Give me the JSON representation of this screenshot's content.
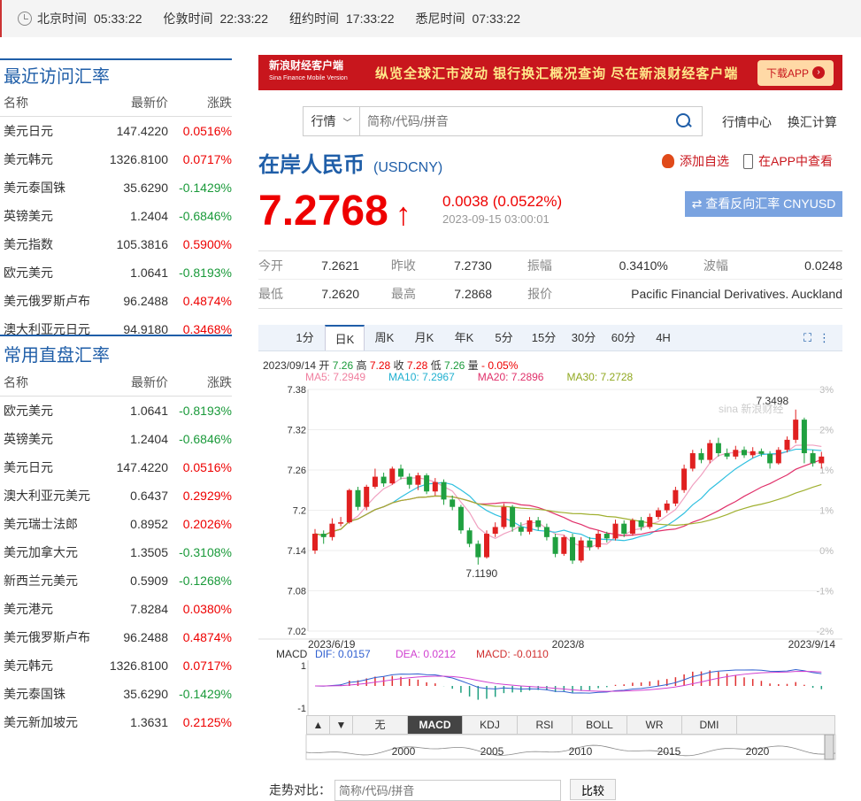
{
  "topbar": {
    "zones": [
      {
        "name": "北京时间",
        "time": "05:33:22"
      },
      {
        "name": "伦敦时间",
        "time": "22:33:22"
      },
      {
        "name": "纽约时间",
        "time": "17:33:22"
      },
      {
        "name": "悉尼时间",
        "time": "07:33:22"
      }
    ]
  },
  "recent": {
    "title": "最近访问汇率",
    "headers": [
      "名称",
      "最新价",
      "涨跌"
    ],
    "rows": [
      [
        "美元日元",
        "147.4220",
        "0.0516%",
        "up"
      ],
      [
        "美元韩元",
        "1326.8100",
        "0.0717%",
        "up"
      ],
      [
        "美元泰国铢",
        "35.6290",
        "-0.1429%",
        "dn"
      ],
      [
        "英镑美元",
        "1.2404",
        "-0.6846%",
        "dn"
      ],
      [
        "美元指数",
        "105.3816",
        "0.5900%",
        "up"
      ],
      [
        "欧元美元",
        "1.0641",
        "-0.8193%",
        "dn"
      ],
      [
        "美元俄罗斯卢布",
        "96.2488",
        "0.4874%",
        "up"
      ],
      [
        "澳大利亚元日元",
        "94.9180",
        "0.3468%",
        "up"
      ]
    ]
  },
  "common": {
    "title": "常用直盘汇率",
    "headers": [
      "名称",
      "最新价",
      "涨跌"
    ],
    "rows": [
      [
        "欧元美元",
        "1.0641",
        "-0.8193%",
        "dn"
      ],
      [
        "英镑美元",
        "1.2404",
        "-0.6846%",
        "dn"
      ],
      [
        "美元日元",
        "147.4220",
        "0.0516%",
        "up"
      ],
      [
        "澳大利亚元美元",
        "0.6437",
        "0.2929%",
        "up"
      ],
      [
        "美元瑞士法郎",
        "0.8952",
        "0.2026%",
        "up"
      ],
      [
        "美元加拿大元",
        "1.3505",
        "-0.3108%",
        "dn"
      ],
      [
        "新西兰元美元",
        "0.5909",
        "-0.1268%",
        "dn"
      ],
      [
        "美元港元",
        "7.8284",
        "0.0380%",
        "up"
      ],
      [
        "美元俄罗斯卢布",
        "96.2488",
        "0.4874%",
        "up"
      ],
      [
        "美元韩元",
        "1326.8100",
        "0.0717%",
        "up"
      ],
      [
        "美元泰国铢",
        "35.6290",
        "-0.1429%",
        "dn"
      ],
      [
        "美元新加坡元",
        "1.3631",
        "0.2125%",
        "up"
      ]
    ]
  },
  "banner": {
    "logo_cn": "新浪财经客户端",
    "logo_en": "Sina Finance Mobile Version",
    "slogan": "纵览全球汇市波动  银行换汇概况查询  尽在新浪财经客户端",
    "download": "下载APP"
  },
  "search": {
    "select": "行情",
    "placeholder": "简称/代码/拼音"
  },
  "links": [
    "行情中心",
    "换汇计算"
  ],
  "quote": {
    "name": "在岸人民币",
    "code": "(USDCNY)",
    "add": "添加自选",
    "app": "在APP中查看",
    "price": "7.2768",
    "arrow": "↑",
    "change": "0.0038 (0.0522%)",
    "time": "2023-09-15 03:00:01",
    "reverse": "⇄ 查看反向汇率 CNYUSD"
  },
  "stats": [
    [
      [
        "今开",
        "7.2621"
      ],
      [
        "昨收",
        "7.2730"
      ],
      [
        "振幅",
        "0.3410%"
      ],
      [
        "波幅",
        "0.0248"
      ]
    ],
    [
      [
        "最低",
        "7.2620"
      ],
      [
        "最高",
        "7.2868"
      ],
      [
        "报价",
        "Pacific Financial Derivatives. Auckland"
      ]
    ]
  ],
  "tabs": [
    "1分",
    "日K",
    "周K",
    "月K",
    "年K",
    "5分",
    "15分",
    "30分",
    "60分",
    "4H"
  ],
  "kinfo": {
    "date": "2023/09/14",
    "open_l": "开",
    "open": "7.26",
    "high_l": "高",
    "high": "7.28",
    "close_l": "收",
    "close": "7.28",
    "low_l": "低",
    "low": "7.26",
    "chg_l": "量",
    "chg": "- 0.05%"
  },
  "ma": [
    "MA5: 7.2949",
    "MA10: 7.2967",
    "MA20: 7.2896",
    "MA30: 7.2728"
  ],
  "macd": {
    "label": "MACD",
    "dif": "DIF: 0.0157",
    "dea": "DEA: 0.0212",
    "macd": "MACD: -0.0110"
  },
  "indicators": [
    "无",
    "MACD",
    "KDJ",
    "RSI",
    "BOLL",
    "WR",
    "DMI"
  ],
  "compare": {
    "label": "走势对比：",
    "placeholder": "简称/代码/拼音",
    "button": "比较"
  },
  "chart_data": {
    "type": "candlestick",
    "yticks": [
      "7.38",
      "7.32",
      "7.26",
      "7.2",
      "7.14",
      "7.08",
      "7.02"
    ],
    "ylim": [
      7.02,
      7.38
    ],
    "pct_ticks": [
      "3%",
      "2%",
      "1%",
      "1%",
      "0%",
      "-1%",
      "-2%"
    ],
    "xlabels": [
      "2023/6/19",
      "2023/8",
      "2023/9/14"
    ],
    "high_label": "7.3498",
    "low_label": "7.1190",
    "macd_ticks": [
      "1",
      "-1"
    ],
    "range_years": [
      "2000",
      "2005",
      "2010",
      "2015",
      "2020"
    ],
    "candles": [
      [
        7.14,
        7.165,
        7.172,
        7.135
      ],
      [
        7.165,
        7.16,
        7.17,
        7.15
      ],
      [
        7.16,
        7.18,
        7.188,
        7.155
      ],
      [
        7.18,
        7.182,
        7.19,
        7.176
      ],
      [
        7.182,
        7.23,
        7.232,
        7.18
      ],
      [
        7.23,
        7.205,
        7.235,
        7.2
      ],
      [
        7.205,
        7.235,
        7.238,
        7.2
      ],
      [
        7.235,
        7.25,
        7.262,
        7.232
      ],
      [
        7.25,
        7.24,
        7.256,
        7.235
      ],
      [
        7.24,
        7.262,
        7.265,
        7.238
      ],
      [
        7.262,
        7.25,
        7.268,
        7.246
      ],
      [
        7.25,
        7.238,
        7.255,
        7.232
      ],
      [
        7.238,
        7.252,
        7.256,
        7.23
      ],
      [
        7.252,
        7.228,
        7.255,
        7.224
      ],
      [
        7.228,
        7.242,
        7.248,
        7.222
      ],
      [
        7.242,
        7.216,
        7.246,
        7.208
      ],
      [
        7.216,
        7.205,
        7.222,
        7.2
      ],
      [
        7.205,
        7.17,
        7.208,
        7.165
      ],
      [
        7.17,
        7.15,
        7.174,
        7.145
      ],
      [
        7.15,
        7.13,
        7.155,
        7.119
      ],
      [
        7.13,
        7.165,
        7.17,
        7.128
      ],
      [
        7.165,
        7.175,
        7.182,
        7.16
      ],
      [
        7.175,
        7.205,
        7.21,
        7.172
      ],
      [
        7.205,
        7.175,
        7.208,
        7.168
      ],
      [
        7.175,
        7.168,
        7.182,
        7.162
      ],
      [
        7.168,
        7.185,
        7.19,
        7.164
      ],
      [
        7.185,
        7.175,
        7.19,
        7.17
      ],
      [
        7.175,
        7.16,
        7.18,
        7.155
      ],
      [
        7.16,
        7.135,
        7.165,
        7.13
      ],
      [
        7.135,
        7.16,
        7.163,
        7.132
      ],
      [
        7.16,
        7.125,
        7.165,
        7.12
      ],
      [
        7.125,
        7.155,
        7.16,
        7.122
      ],
      [
        7.155,
        7.145,
        7.16,
        7.14
      ],
      [
        7.145,
        7.165,
        7.17,
        7.142
      ],
      [
        7.165,
        7.158,
        7.168,
        7.152
      ],
      [
        7.158,
        7.18,
        7.186,
        7.155
      ],
      [
        7.18,
        7.165,
        7.185,
        7.16
      ],
      [
        7.165,
        7.185,
        7.188,
        7.162
      ],
      [
        7.185,
        7.175,
        7.19,
        7.17
      ],
      [
        7.175,
        7.19,
        7.195,
        7.172
      ],
      [
        7.19,
        7.2,
        7.204,
        7.186
      ],
      [
        7.2,
        7.21,
        7.215,
        7.196
      ],
      [
        7.21,
        7.23,
        7.235,
        7.206
      ],
      [
        7.23,
        7.262,
        7.268,
        7.226
      ],
      [
        7.262,
        7.285,
        7.29,
        7.258
      ],
      [
        7.285,
        7.275,
        7.292,
        7.27
      ],
      [
        7.275,
        7.3,
        7.305,
        7.27
      ],
      [
        7.3,
        7.285,
        7.308,
        7.28
      ],
      [
        7.285,
        7.28,
        7.292,
        7.276
      ],
      [
        7.28,
        7.29,
        7.296,
        7.276
      ],
      [
        7.29,
        7.282,
        7.295,
        7.278
      ],
      [
        7.282,
        7.288,
        7.294,
        7.278
      ],
      [
        7.288,
        7.284,
        7.292,
        7.28
      ],
      [
        7.284,
        7.27,
        7.288,
        7.262
      ],
      [
        7.27,
        7.29,
        7.294,
        7.268
      ],
      [
        7.29,
        7.305,
        7.31,
        7.286
      ],
      [
        7.305,
        7.335,
        7.35,
        7.3
      ],
      [
        7.335,
        7.285,
        7.338,
        7.27
      ],
      [
        7.285,
        7.27,
        7.29,
        7.265
      ],
      [
        7.27,
        7.28,
        7.287,
        7.262
      ]
    ]
  }
}
